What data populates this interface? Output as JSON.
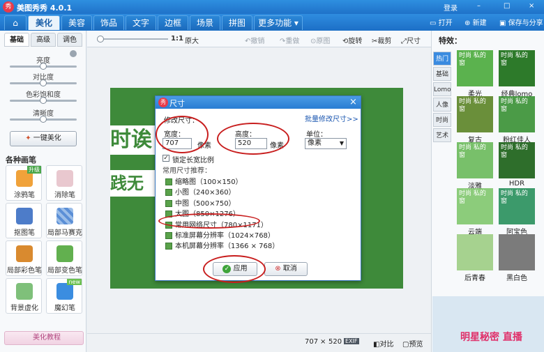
{
  "app": {
    "title": "美图秀秀 4.0.1",
    "logo_text": "秀",
    "login": "登录"
  },
  "window_controls": {
    "min": "–",
    "max": "□",
    "close": "×"
  },
  "menu": {
    "home_icon": "home-icon",
    "tabs": [
      "美化",
      "美容",
      "饰品",
      "文字",
      "边框",
      "场景",
      "拼图"
    ],
    "more": "更多功能 ▾",
    "open": "打开",
    "new": "新建",
    "save_share": "保存与分享"
  },
  "toolbar": {
    "ratio": "1:1",
    "original_size": "原大",
    "undo": "撤销",
    "redo": "重做",
    "original": "原图",
    "rotate": "旋转",
    "crop": "裁剪",
    "size": "尺寸"
  },
  "left": {
    "tabs": [
      "基础",
      "高级",
      "调色"
    ],
    "sliders": [
      {
        "label": "亮度",
        "value": 0.5
      },
      {
        "label": "对比度",
        "value": 0.5
      },
      {
        "label": "色彩饱和度",
        "value": 0.5
      },
      {
        "label": "清晰度",
        "value": 0.5
      }
    ],
    "one_click": "一键美化",
    "brush_title": "各种画笔",
    "tools": [
      {
        "label": "涂鸦笔",
        "badge": "升级"
      },
      {
        "label": "消除笔",
        "badge": ""
      },
      {
        "label": "抠图笔",
        "badge": ""
      },
      {
        "label": "局部马赛克",
        "badge": ""
      },
      {
        "label": "局部彩色笔",
        "badge": ""
      },
      {
        "label": "局部变色笔",
        "badge": ""
      },
      {
        "label": "背景虚化",
        "badge": ""
      },
      {
        "label": "魔幻笔",
        "badge": "new"
      }
    ],
    "tutorial": "美化教程"
  },
  "dialog": {
    "title": "尺寸",
    "logo_text": "秀",
    "section": "修改尺寸：",
    "batch_link": "批量修改尺寸>>",
    "width_label": "宽度：",
    "width_value": "707",
    "height_label": "高度：",
    "height_value": "520",
    "unit_px": "像素",
    "unit_label": "单位：",
    "unit_value": "像素",
    "lock_ratio": "锁定长宽比例",
    "lock_checked": true,
    "presets_title": "常用尺寸推荐：",
    "presets": [
      "缩略图（100×150）",
      "小图（240×360）",
      "中图（500×750）",
      "大图（850×1276）",
      "常用网络尺寸（780×1171）",
      "标准屏幕分辨率（1024×768）",
      "本机屏幕分辨率（1366 × 768）"
    ],
    "apply": "应用",
    "cancel": "取消",
    "close": "×"
  },
  "photo": {
    "text1": "时诶",
    "text2": "践无"
  },
  "status": {
    "w": "707",
    "x": "×",
    "h": "520",
    "exif": "EXIF",
    "compare": "对比",
    "preview": "预览"
  },
  "right": {
    "heading": "特效：",
    "tabs": [
      "热门",
      "基础",
      "Lomo",
      "人像",
      "时尚",
      "艺术"
    ],
    "effects": [
      {
        "label": "柔光",
        "thumb": "时尚 私的窗",
        "color": "#5bb24e"
      },
      {
        "label": "经典lomo",
        "thumb": "时尚 私的窗",
        "color": "#2d7a2a"
      },
      {
        "label": "复古",
        "thumb": "时尚 私的窗",
        "color": "#6a8f3a"
      },
      {
        "label": "粉红佳人",
        "thumb": "时尚 私的窗",
        "color": "#4b9b47"
      },
      {
        "label": "淡雅",
        "thumb": "时尚 私的窗",
        "color": "#78c06a"
      },
      {
        "label": "HDR",
        "thumb": "时尚 私的窗",
        "color": "#2e6e2b"
      },
      {
        "label": "云端",
        "thumb": "时尚 私的窗",
        "color": "#8ccc7b"
      },
      {
        "label": "阿宝色",
        "thumb": "时尚 私的窗",
        "color": "#3c9a6b"
      },
      {
        "label": "后青春",
        "thumb": "",
        "color": "#a6d28f"
      },
      {
        "label": "黑白色",
        "thumb": "",
        "color": "#7b7b7b"
      }
    ]
  },
  "ad": {
    "text": "明星秘密 直播"
  }
}
